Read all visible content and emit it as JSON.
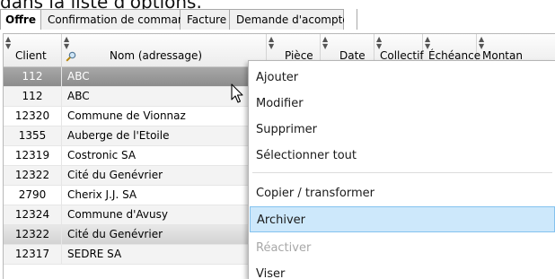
{
  "caption": {
    "text": "dans la liste d'options."
  },
  "tabs": [
    {
      "label": "Offre"
    },
    {
      "label": "Confirmation de commande"
    },
    {
      "label": "Facture"
    },
    {
      "label": "Demande d'acompte"
    }
  ],
  "columns": {
    "client": "Client",
    "nom": "Nom (adressage)",
    "piece": "Pièce",
    "date": "Date",
    "collectif": "Collectif",
    "echeance": "Échéance",
    "montant": "Montan"
  },
  "rows": [
    {
      "client": "112",
      "nom": "ABC"
    },
    {
      "client": "112",
      "nom": "ABC"
    },
    {
      "client": "12320",
      "nom": "Commune de Vionnaz"
    },
    {
      "client": "1355",
      "nom": "Auberge de l'Etoile"
    },
    {
      "client": "12319",
      "nom": "Costronic SA"
    },
    {
      "client": "12322",
      "nom": "Cité du Genévrier"
    },
    {
      "client": "2790",
      "nom": "Cherix J.J. SA"
    },
    {
      "client": "12324",
      "nom": "Commune d'Avusy"
    },
    {
      "client": "12322",
      "nom": "Cité du Genévrier"
    },
    {
      "client": "12317",
      "nom": "SEDRE SA"
    }
  ],
  "context_menu": {
    "items": [
      {
        "label": "Ajouter"
      },
      {
        "label": "Modifier"
      },
      {
        "label": "Supprimer"
      },
      {
        "label": "Sélectionner tout"
      },
      {
        "label": "Copier / transformer"
      },
      {
        "label": "Archiver"
      },
      {
        "label": "Réactiver"
      },
      {
        "label": "Viser"
      }
    ]
  },
  "colors": {
    "menu_highlight": "#cde8fb",
    "menu_highlight_border": "#84c2ee",
    "selected_row": "#999999"
  },
  "icons": {
    "header_search": "magnifier-icon",
    "pointer": "mouse-pointer-icon"
  }
}
